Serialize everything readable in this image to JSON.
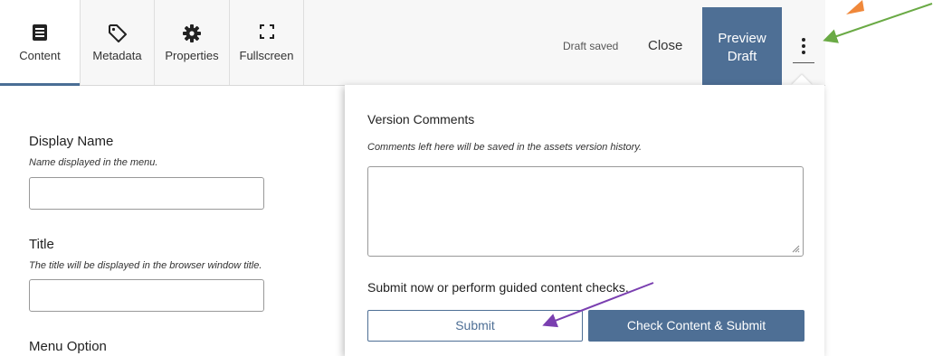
{
  "toolbar": {
    "tabs": [
      {
        "label": "Content",
        "icon": "content-icon",
        "active": true
      },
      {
        "label": "Metadata",
        "icon": "tag-icon",
        "active": false
      },
      {
        "label": "Properties",
        "icon": "gear-icon",
        "active": false
      },
      {
        "label": "Fullscreen",
        "icon": "fullscreen-icon",
        "active": false
      }
    ],
    "status": "Draft saved",
    "close_label": "Close",
    "preview_label_line1": "Preview",
    "preview_label_line2": "Draft",
    "more_icon": "vertical-ellipsis-icon"
  },
  "form": {
    "fields": [
      {
        "label": "Display Name",
        "help": "Name displayed in the menu.",
        "value": ""
      },
      {
        "label": "Title",
        "help": "The title will be displayed in the browser window title.",
        "value": ""
      },
      {
        "label": "Menu Option"
      }
    ]
  },
  "panel": {
    "title": "Version Comments",
    "help": "Comments left here will be saved in the assets version history.",
    "comment_value": "",
    "submit_prompt": "Submit now or perform guided content checks.",
    "submit_label": "Submit",
    "check_label": "Check Content & Submit"
  },
  "colors": {
    "accent": "#4e6f95",
    "annotation_orange": "#f0883a",
    "annotation_green": "#6aaa45",
    "annotation_purple": "#7a3fb0"
  }
}
